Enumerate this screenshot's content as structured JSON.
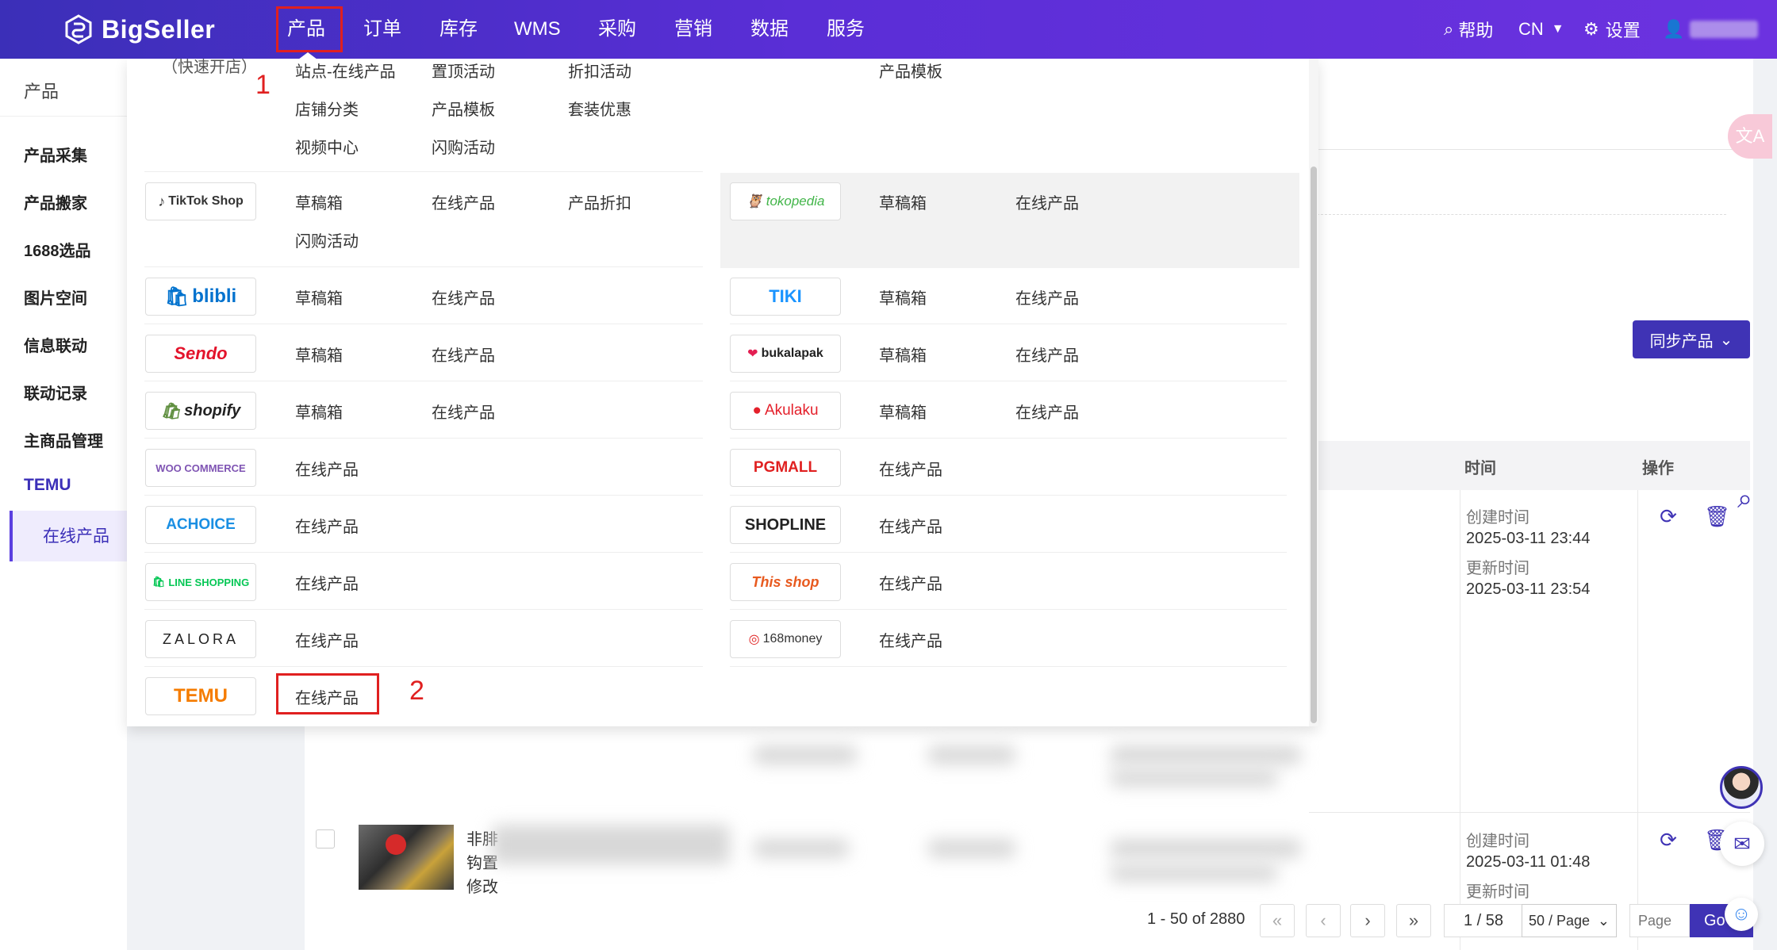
{
  "app": {
    "logo_text": "BigSeller"
  },
  "topnav": {
    "items": [
      "产品",
      "订单",
      "库存",
      "WMS",
      "采购",
      "营销",
      "数据",
      "服务"
    ],
    "help": "帮助",
    "lang": "CN",
    "settings": "设置"
  },
  "sidebar": {
    "title": "产品",
    "items": [
      "产品采集",
      "产品搬家",
      "1688选品",
      "图片空间",
      "信息联动",
      "联动记录",
      "主商品管理"
    ],
    "section": "TEMU",
    "active": "在线产品"
  },
  "menu": {
    "partial_top": {
      "left_label": "（快速开店）",
      "col1": [
        "站点-在线产品",
        "店铺分类",
        "视频中心"
      ],
      "col2": [
        "置顶活动",
        "产品模板",
        "闪购活动"
      ],
      "col3": [
        "折扣活动",
        "套装优惠"
      ],
      "right": [
        "产品模板"
      ]
    },
    "platforms_left": [
      {
        "name": "TikTok Shop",
        "links": [
          "草稿箱",
          "在线产品",
          "产品折扣",
          "闪购活动"
        ]
      },
      {
        "name": "blibli",
        "links": [
          "草稿箱",
          "在线产品"
        ]
      },
      {
        "name": "Sendo",
        "links": [
          "草稿箱",
          "在线产品"
        ]
      },
      {
        "name": "shopify",
        "links": [
          "草稿箱",
          "在线产品"
        ]
      },
      {
        "name": "WOO COMMERCE",
        "links": [
          "在线产品"
        ]
      },
      {
        "name": "ACHOICE",
        "links": [
          "在线产品"
        ]
      },
      {
        "name": "LINE SHOPPING",
        "links": [
          "在线产品"
        ]
      },
      {
        "name": "ZALORA",
        "links": [
          "在线产品"
        ]
      },
      {
        "name": "TEMU",
        "links": [
          "在线产品"
        ]
      }
    ],
    "platforms_right": [
      {
        "name": "tokopedia",
        "links": [
          "草稿箱",
          "在线产品"
        ]
      },
      {
        "name": "TIKI",
        "links": [
          "草稿箱",
          "在线产品"
        ]
      },
      {
        "name": "bukalapak",
        "links": [
          "草稿箱",
          "在线产品"
        ]
      },
      {
        "name": "Akulaku",
        "links": [
          "草稿箱",
          "在线产品"
        ]
      },
      {
        "name": "PGMALL",
        "links": [
          "在线产品"
        ]
      },
      {
        "name": "SHOPLINE",
        "links": [
          "在线产品"
        ]
      },
      {
        "name": "This shop",
        "links": [
          "在线产品"
        ]
      },
      {
        "name": "168money",
        "links": [
          "在线产品"
        ]
      }
    ],
    "annotations": [
      "1",
      "2"
    ]
  },
  "page": {
    "sync_button": "同步产品",
    "table_headers": {
      "time": "时间",
      "action": "操作"
    },
    "rows": [
      {
        "created_label": "创建时间",
        "created": "2025-03-11 23:44",
        "updated_label": "更新时间",
        "updated": "2025-03-11 23:54"
      },
      {
        "created_label": "创建时间",
        "created": "2025-03-11 01:48",
        "updated_label": "更新时间"
      }
    ],
    "product_name_lines": [
      "非腓",
      "钩置",
      "修改"
    ],
    "pagination": {
      "summary": "1 - 50 of 2880",
      "page": "1 / 58",
      "page_size": "50 / Page",
      "page_placeholder": "Page",
      "go": "Go"
    }
  },
  "colors": {
    "nav_start": "#3b2fb8",
    "nav_end": "#6c32e0",
    "accent": "#3f33b5",
    "annotation": "#e02020"
  }
}
